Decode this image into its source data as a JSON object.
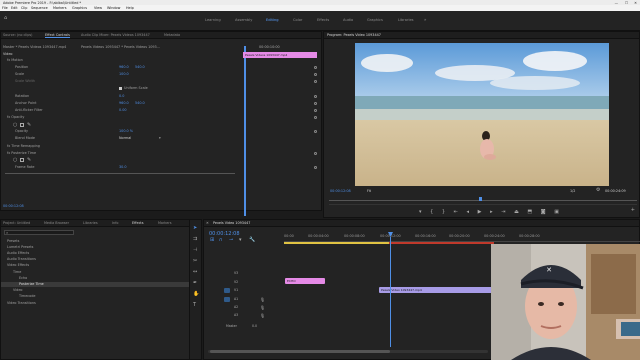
{
  "app": {
    "title": "Adobe Premiere Pro 2019 - F:\\ablbal\\Untitled *",
    "window_controls": [
      "—",
      "☐",
      "✕"
    ]
  },
  "menu": [
    "File",
    "Edit",
    "Clip",
    "Sequence",
    "Markers",
    "Graphics",
    "View",
    "Window",
    "Help"
  ],
  "workspaces": [
    "Learning",
    "Assembly",
    "Editing",
    "Color",
    "Effects",
    "Audio",
    "Graphics",
    "Libraries"
  ],
  "active_workspace": "Editing",
  "source_panel": {
    "tabs": [
      "Source: (no clips)",
      "Effect Controls",
      "Audio Clip Mixer: Pexels Videos 1093447",
      "Metadata"
    ],
    "master": "Master * Pexels Videos 1093447.mp4",
    "clip": "Pexels Videos 1093447 * Pexels Videos 1093...",
    "mini_timecode": "00:00:10:00",
    "mini_clip": "Pexels Videos 1093447.mp4",
    "sections": {
      "video": "Video",
      "motion": "Motion",
      "opacity": "Opacity",
      "time_remap": "Time Remapping",
      "posterize": "Posterize Time"
    },
    "props": [
      {
        "name": "Position",
        "v1": "960.0",
        "v2": "540.0"
      },
      {
        "name": "Scale",
        "v1": "100.0",
        "v2": ""
      },
      {
        "name": "Scale Width",
        "v1": "",
        "v2": ""
      },
      {
        "name": "Uniform Scale",
        "v1": "",
        "v2": ""
      },
      {
        "name": "Rotation",
        "v1": "0.0",
        "v2": ""
      },
      {
        "name": "Anchor Point",
        "v1": "960.0",
        "v2": "540.0"
      },
      {
        "name": "Anti-flicker Filter",
        "v1": "0.00",
        "v2": ""
      },
      {
        "name": "Opacity",
        "v1": "100.0 %",
        "v2": ""
      },
      {
        "name": "Blend Mode",
        "v1": "Normal",
        "v2": ""
      },
      {
        "name": "Frame Rate",
        "v1": "30.0",
        "v2": ""
      }
    ],
    "bottom_timecode": "00:00:12:08"
  },
  "program": {
    "title": "Program: Pexels Video 1093447",
    "timecode": "00:00:12:08",
    "fit": "Fit",
    "quality": "1/2",
    "duration": "00:00:24:09"
  },
  "project": {
    "tabs": [
      "Project: Untitled",
      "Media Browser",
      "Libraries",
      "Info",
      "Effects",
      "Markers"
    ],
    "tree": [
      "Presets",
      "Lumetri Presets",
      "Audio Effects",
      "Audio Transitions",
      "Video Effects",
      "Time",
      "Echo",
      "Posterize Time",
      "Video",
      "Timecode",
      "Video Transitions"
    ]
  },
  "timeline": {
    "title": "Pexels Video 1093447",
    "timecode": "00:00:12:08",
    "ruler": [
      "00:00",
      "00:00:04:00",
      "00:00:08:00",
      "00:00:12:00",
      "00:00:16:00",
      "00:00:20:00",
      "00:00:24:00",
      "00:00:28:00"
    ],
    "tracks": [
      "V3",
      "V2",
      "V1",
      "A1",
      "A2",
      "A3"
    ],
    "master": "Master",
    "master_val": "0.0",
    "clips": {
      "v2": "ECHO",
      "v1": "Pexels Video 1093447.mp4"
    }
  },
  "colors": {
    "accent": "#4f8fe6",
    "clip_pink": "#e58ae6",
    "clip_lavender": "#a79be6",
    "playhead": "#4f8fe6",
    "workarea": "#e0c343"
  }
}
